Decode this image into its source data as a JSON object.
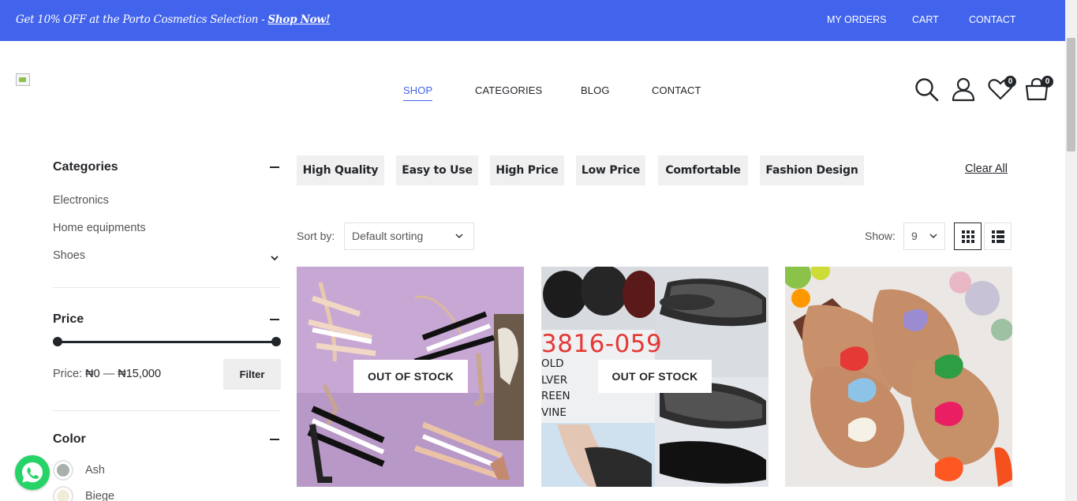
{
  "topbar": {
    "promo_text": "Get 10% OFF at the Porto Cosmetics Selection - ",
    "promo_link": "Shop Now!",
    "links": [
      "MY ORDERS",
      "CART",
      "CONTACT"
    ],
    "background": "#4263eb"
  },
  "header": {
    "nav": [
      "SHOP",
      "CATEGORIES",
      "BLOG",
      "CONTACT"
    ],
    "active_nav": "SHOP",
    "icons": [
      "search-icon",
      "user-icon",
      "heart-icon",
      "cart-icon"
    ],
    "wishlist_count": "0",
    "cart_count": "0"
  },
  "sidebar": {
    "categories": {
      "title": "Categories",
      "items": [
        "Electronics",
        "Home equipments",
        "Shoes"
      ]
    },
    "price": {
      "title": "Price",
      "label": "Price:",
      "min": "₦0",
      "separator": "—",
      "max": "₦15,000",
      "filter_label": "Filter"
    },
    "color": {
      "title": "Color",
      "items": [
        {
          "label": "Ash",
          "hex": "#a8b0ab"
        },
        {
          "label": "Biege",
          "hex": "#f1ecd6"
        }
      ]
    }
  },
  "tags": {
    "items": [
      "High Quality",
      "Easy to Use",
      "High Price",
      "Low Price",
      "Comfortable",
      "Fashion Design"
    ],
    "clear_label": "Clear All"
  },
  "toolbar": {
    "sort_label": "Sort by:",
    "sort_value": "Default sorting",
    "show_label": "Show:",
    "show_value": "9",
    "active_view": "grid"
  },
  "products": [
    {
      "image": "strappy block-heel sandals",
      "badge": "OUT OF STOCK"
    },
    {
      "image": "mesh wedge slippers",
      "badge": "OUT OF STOCK",
      "image_text": {
        "phone": "3816-059",
        "colors": [
          "OLD",
          "LVER",
          "REEN",
          "VINE"
        ]
      }
    },
    {
      "image": "bow flat slippers",
      "badge": ""
    }
  ],
  "accent_color": "#4263eb",
  "whatsapp_color": "#25d366"
}
